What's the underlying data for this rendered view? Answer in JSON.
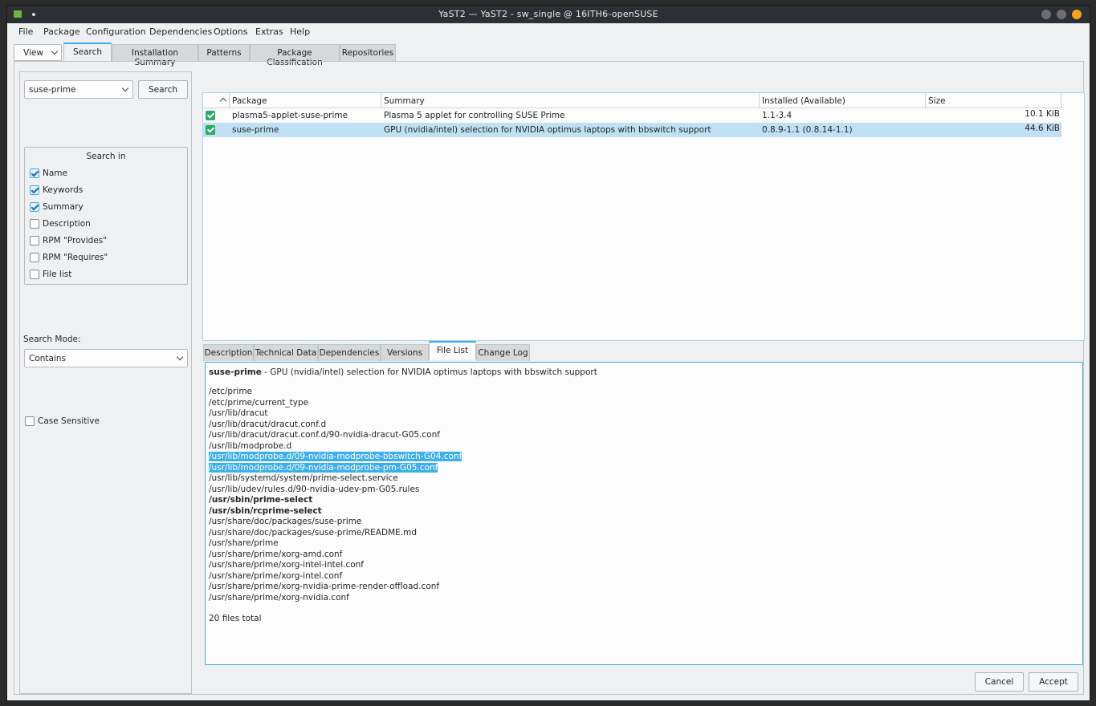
{
  "window": {
    "title": "YaST2 — YaST2 - sw_single @ 16ITH6-openSUSE"
  },
  "menu": [
    "File",
    "Package",
    "Configuration",
    "Dependencies",
    "Options",
    "Extras",
    "Help"
  ],
  "view_button": {
    "label": "View"
  },
  "tabs": [
    "Search",
    "Installation Summary",
    "Patterns",
    "Package Classification",
    "Repositories"
  ],
  "search": {
    "query": "suse-prime",
    "button": "Search"
  },
  "search_in": {
    "title": "Search in",
    "options": [
      {
        "label": "Name",
        "checked": true
      },
      {
        "label": "Keywords",
        "checked": true
      },
      {
        "label": "Summary",
        "checked": true
      },
      {
        "label": "Description",
        "checked": false
      },
      {
        "label": "RPM \"Provides\"",
        "checked": false
      },
      {
        "label": "RPM \"Requires\"",
        "checked": false
      },
      {
        "label": "File list",
        "checked": false
      }
    ]
  },
  "search_mode": {
    "label": "Search Mode:",
    "value": "Contains"
  },
  "case_sensitive": {
    "label": "Case Sensitive",
    "checked": false
  },
  "table": {
    "columns": [
      "Package",
      "Summary",
      "Installed (Available)",
      "Size"
    ],
    "rows": [
      {
        "package": "plasma5-applet-suse-prime",
        "summary": "Plasma 5 applet for controlling SUSE Prime",
        "installed": "1.1-3.4",
        "size": "10.1 KiB",
        "selected": false
      },
      {
        "package": "suse-prime",
        "summary": "GPU (nvidia/intel) selection for NVIDIA optimus laptops with bbswitch support",
        "installed": "0.8.9-1.1 (0.8.14-1.1)",
        "size": "44.6 KiB",
        "selected": true
      }
    ]
  },
  "detail_tabs": [
    "Description",
    "Technical Data",
    "Dependencies",
    "Versions",
    "File List",
    "Change Log"
  ],
  "file_list": {
    "package": "suse-prime",
    "summary": " - GPU (nvidia/intel) selection for NVIDIA optimus laptops with bbswitch support",
    "files": [
      {
        "path": "/etc/prime",
        "style": ""
      },
      {
        "path": "/etc/prime/current_type",
        "style": ""
      },
      {
        "path": "/usr/lib/dracut",
        "style": ""
      },
      {
        "path": "/usr/lib/dracut/dracut.conf.d",
        "style": ""
      },
      {
        "path": "/usr/lib/dracut/dracut.conf.d/90-nvidia-dracut-G05.conf",
        "style": ""
      },
      {
        "path": "/usr/lib/modprobe.d",
        "style": ""
      },
      {
        "path": "/usr/lib/modprobe.d/09-nvidia-modprobe-bbswitch-G04.conf",
        "style": "hl"
      },
      {
        "path": "/usr/lib/modprobe.d/09-nvidia-modprobe-pm-G05.conf",
        "style": "hl"
      },
      {
        "path": "/usr/lib/systemd/system/prime-select.service",
        "style": ""
      },
      {
        "path": "/usr/lib/udev/rules.d/90-nvidia-udev-pm-G05.rules",
        "style": ""
      },
      {
        "path": "/usr/sbin/prime-select",
        "style": "b"
      },
      {
        "path": "/usr/sbin/rcprime-select",
        "style": "b"
      },
      {
        "path": "/usr/share/doc/packages/suse-prime",
        "style": ""
      },
      {
        "path": "/usr/share/doc/packages/suse-prime/README.md",
        "style": ""
      },
      {
        "path": "/usr/share/prime",
        "style": ""
      },
      {
        "path": "/usr/share/prime/xorg-amd.conf",
        "style": ""
      },
      {
        "path": "/usr/share/prime/xorg-intel-intel.conf",
        "style": ""
      },
      {
        "path": "/usr/share/prime/xorg-intel.conf",
        "style": ""
      },
      {
        "path": "/usr/share/prime/xorg-nvidia-prime-render-offload.conf",
        "style": ""
      },
      {
        "path": "/usr/share/prime/xorg-nvidia.conf",
        "style": ""
      }
    ],
    "total": "20 files total"
  },
  "buttons": {
    "cancel": "Cancel",
    "accept": "Accept"
  }
}
